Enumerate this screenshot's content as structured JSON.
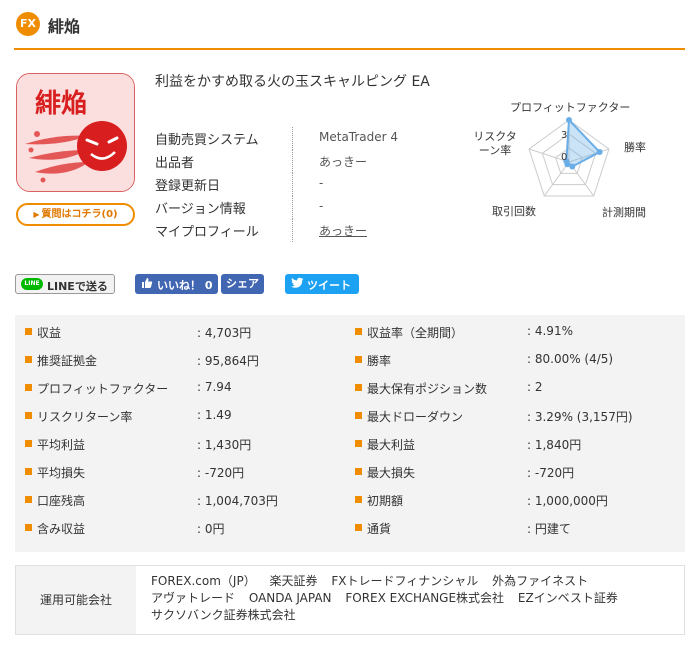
{
  "header": {
    "badge": "FX",
    "title": "緋焔"
  },
  "product": {
    "logo_text": "緋焔",
    "question_button": "質問はコチラ(0)",
    "title": "利益をかすめ取る火の玉スキャルピング EA",
    "info": [
      {
        "label": "自動売買システム",
        "value": "MetaTrader 4"
      },
      {
        "label": "出品者",
        "value": "あっきー"
      },
      {
        "label": "登録更新日",
        "value": "-"
      },
      {
        "label": "バージョン情報",
        "value": "-"
      },
      {
        "label": "マイプロフィール",
        "value": "あっきー"
      }
    ]
  },
  "radar": {
    "axes": [
      "プロフィットファクター",
      "勝率",
      "計測期間",
      "取引回数",
      "リスクターン率"
    ],
    "scale_labels": [
      "3",
      "0"
    ],
    "values": [
      3,
      2.3,
      0.4,
      0.2,
      0.2
    ],
    "max": 3,
    "color": "#6aaee8"
  },
  "social": {
    "line": "LINEで送る",
    "line_icon": "LINE",
    "fb_like": "いいね！ 0",
    "fb_share": "シェア",
    "tweet": "ツイート"
  },
  "stats": {
    "left": [
      {
        "label": "収益",
        "value": ": 4,703円"
      },
      {
        "label": "推奨証拠金",
        "value": ": 95,864円"
      },
      {
        "label": "プロフィットファクター",
        "value": ": 7.94"
      },
      {
        "label": "リスクリターン率",
        "value": ": 1.49"
      },
      {
        "label": "平均利益",
        "value": ": 1,430円"
      },
      {
        "label": "平均損失",
        "value": ": -720円"
      },
      {
        "label": "口座残高",
        "value": ": 1,004,703円"
      },
      {
        "label": "含み収益",
        "value": ": 0円"
      }
    ],
    "right": [
      {
        "label": "収益率（全期間）",
        "value": ": 4.91%"
      },
      {
        "label": "勝率",
        "value": ": 80.00% (4/5)"
      },
      {
        "label": "最大保有ポジション数",
        "value": ": 2"
      },
      {
        "label": "最大ドローダウン",
        "value": ": 3.29% (3,157円)"
      },
      {
        "label": "最大利益",
        "value": ": 1,840円"
      },
      {
        "label": "最大損失",
        "value": ": -720円"
      },
      {
        "label": "初期額",
        "value": ": 1,000,000円"
      },
      {
        "label": "通貨",
        "value": ": 円建て"
      }
    ]
  },
  "companies": {
    "label": "運用可能会社",
    "list": [
      "FOREX.com（JP）",
      "楽天証券",
      "FXトレードフィナンシャル",
      "外為ファイネスト",
      "アヴァトレード",
      "OANDA JAPAN",
      "FOREX EXCHANGE株式会社",
      "EZインベスト証券",
      "サクソバンク証券株式会社"
    ]
  },
  "colors": {
    "accent": "#f08c00",
    "facebook": "#4267b2",
    "twitter": "#1da1f2",
    "line": "#00b900"
  }
}
